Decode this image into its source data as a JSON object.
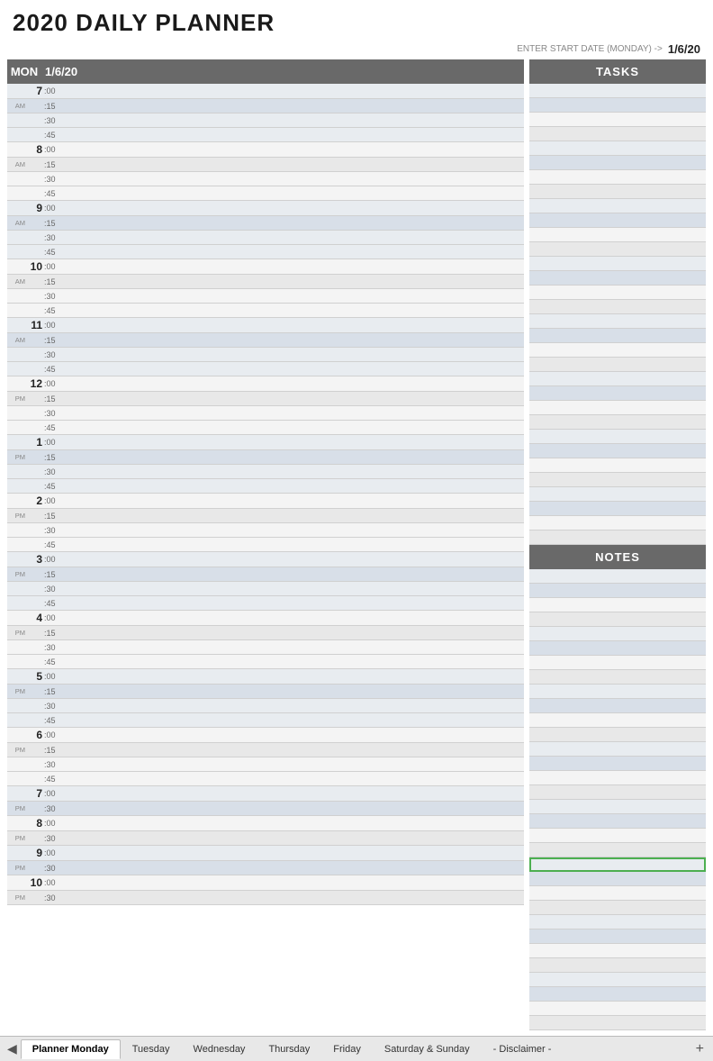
{
  "title": "2020 DAILY PLANNER",
  "start_date_label": "ENTER START DATE (MONDAY) ->",
  "start_date_value": "1/6/20",
  "header": {
    "day": "MON",
    "date": "1/6/20",
    "tasks": "TASKS",
    "notes": "NOTES"
  },
  "hours": [
    {
      "hour": "7",
      "ampm": "AM",
      "minutes": [
        ":00",
        ":15",
        ":30",
        ":45"
      ]
    },
    {
      "hour": "8",
      "ampm": "AM",
      "minutes": [
        ":00",
        ":15",
        ":30",
        ":45"
      ]
    },
    {
      "hour": "9",
      "ampm": "AM",
      "minutes": [
        ":00",
        ":15",
        ":30",
        ":45"
      ]
    },
    {
      "hour": "10",
      "ampm": "AM",
      "minutes": [
        ":00",
        ":15",
        ":30",
        ":45"
      ]
    },
    {
      "hour": "11",
      "ampm": "AM",
      "minutes": [
        ":00",
        ":15",
        ":30",
        ":45"
      ]
    },
    {
      "hour": "12",
      "ampm": "PM",
      "minutes": [
        ":00",
        ":15",
        ":30",
        ":45"
      ]
    },
    {
      "hour": "1",
      "ampm": "PM",
      "minutes": [
        ":00",
        ":15",
        ":30",
        ":45"
      ]
    },
    {
      "hour": "2",
      "ampm": "PM",
      "minutes": [
        ":00",
        ":15",
        ":30",
        ":45"
      ]
    },
    {
      "hour": "3",
      "ampm": "PM",
      "minutes": [
        ":00",
        ":15",
        ":30",
        ":45"
      ]
    },
    {
      "hour": "4",
      "ampm": "PM",
      "minutes": [
        ":00",
        ":15",
        ":30",
        ":45"
      ]
    },
    {
      "hour": "5",
      "ampm": "PM",
      "minutes": [
        ":00",
        ":15",
        ":30",
        ":45"
      ]
    },
    {
      "hour": "6",
      "ampm": "PM",
      "minutes": [
        ":00",
        ":15",
        ":30",
        ":45"
      ]
    },
    {
      "hour": "7",
      "ampm": "PM",
      "minutes": [
        ":00",
        ":30"
      ]
    },
    {
      "hour": "8",
      "ampm": "PM",
      "minutes": [
        ":00",
        ":30"
      ]
    },
    {
      "hour": "9",
      "ampm": "PM",
      "minutes": [
        ":00",
        ":30"
      ]
    },
    {
      "hour": "10",
      "ampm": "PM",
      "minutes": [
        ":00",
        ":30"
      ]
    }
  ],
  "tabs": [
    {
      "label": "Planner Monday",
      "active": true
    },
    {
      "label": "Tuesday",
      "active": false
    },
    {
      "label": "Wednesday",
      "active": false
    },
    {
      "label": "Thursday",
      "active": false
    },
    {
      "label": "Friday",
      "active": false
    },
    {
      "label": "Saturday & Sunday",
      "active": false
    },
    {
      "label": "- Disclaimer -",
      "active": false
    }
  ]
}
